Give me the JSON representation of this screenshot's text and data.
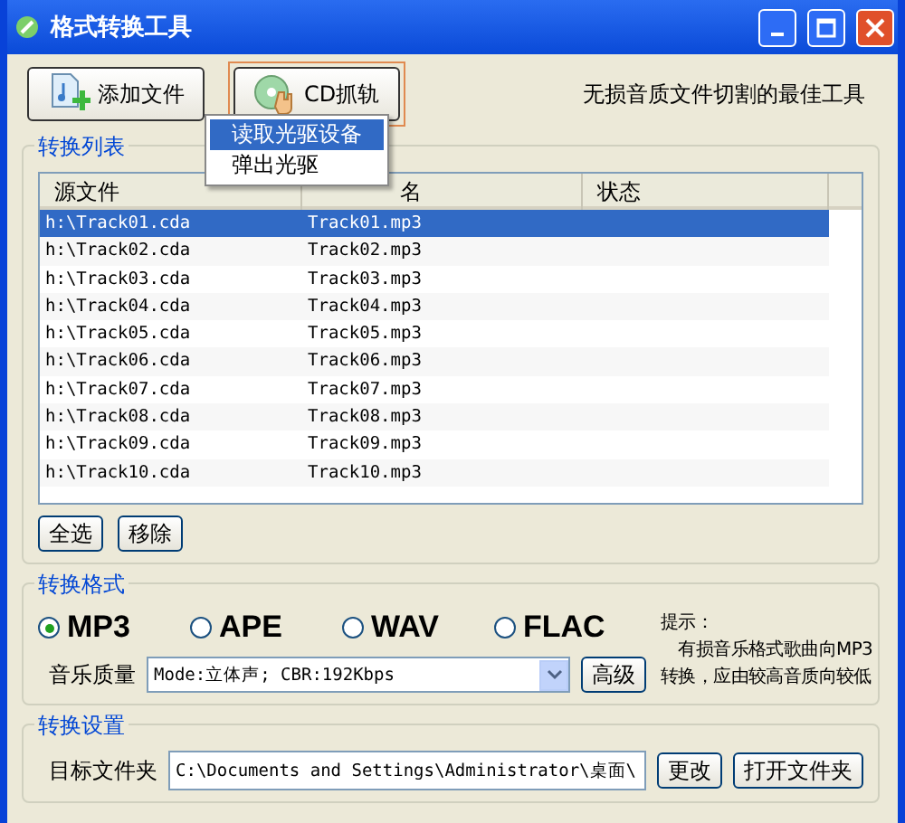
{
  "window": {
    "title": "格式转换工具"
  },
  "toolbar": {
    "buttons": [
      {
        "label": "添加文件",
        "kind": "add",
        "selected": false
      },
      {
        "label": "CD抓轨",
        "kind": "cd",
        "selected": true
      }
    ],
    "slogan": "无损音质文件切割的最佳工具"
  },
  "menu": {
    "items": [
      {
        "label": "读取光驱设备",
        "selected": true
      },
      {
        "label": "弹出光驱",
        "selected": false
      }
    ]
  },
  "list_group": {
    "title": "转换列表",
    "columns": [
      "源文件",
      "名",
      "状态"
    ],
    "rows": [
      {
        "source": "h:\\Track01.cda",
        "target": "Track01.mp3",
        "selected": true
      },
      {
        "source": "h:\\Track02.cda",
        "target": "Track02.mp3",
        "selected": false
      },
      {
        "source": "h:\\Track03.cda",
        "target": "Track03.mp3",
        "selected": false
      },
      {
        "source": "h:\\Track04.cda",
        "target": "Track04.mp3",
        "selected": false
      },
      {
        "source": "h:\\Track05.cda",
        "target": "Track05.mp3",
        "selected": false
      },
      {
        "source": "h:\\Track06.cda",
        "target": "Track06.mp3",
        "selected": false
      },
      {
        "source": "h:\\Track07.cda",
        "target": "Track07.mp3",
        "selected": false
      },
      {
        "source": "h:\\Track08.cda",
        "target": "Track08.mp3",
        "selected": false
      },
      {
        "source": "h:\\Track09.cda",
        "target": "Track09.mp3",
        "selected": false
      },
      {
        "source": "h:\\Track10.cda",
        "target": "Track10.mp3",
        "selected": false
      }
    ],
    "buttons": [
      "全选",
      "移除"
    ]
  },
  "format_group": {
    "title": "转换格式",
    "formats": [
      {
        "label": "MP3",
        "selected": true
      },
      {
        "label": "APE",
        "selected": false
      },
      {
        "label": "WAV",
        "selected": false
      },
      {
        "label": "FLAC",
        "selected": false
      }
    ],
    "quality_label": "音乐质量",
    "quality_value": "Mode:立体声; CBR:192Kbps",
    "advanced_button": "高级",
    "hint": [
      "提示：",
      "　有损音乐格式歌曲向MP3",
      "转换，应由较高音质向较低"
    ]
  },
  "settings_group": {
    "title": "转换设置",
    "folder_label": "目标文件夹",
    "folder_value": "C:\\Documents and Settings\\Administrator\\桌面\\",
    "buttons": [
      "更改",
      "打开文件夹"
    ]
  }
}
